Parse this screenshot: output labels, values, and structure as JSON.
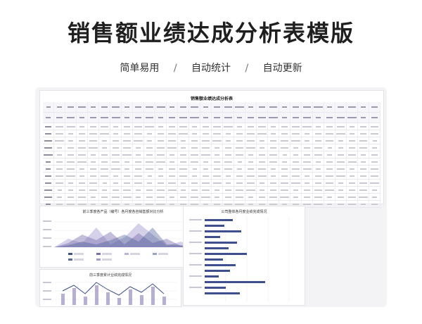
{
  "header": {
    "title": "销售额业绩达成分析表模版",
    "features": [
      "简单易用",
      "自动统计",
      "自动更新"
    ],
    "separator": "/"
  },
  "sheet": {
    "title": "销售额业绩达成分析表"
  },
  "panels": {
    "area_chart_title": "前三季度各产品（编号）各月度各自销售额对比分析",
    "bar_chart_title": "公司整体各月度业绩完成情况",
    "line_chart_title": "前三季度累计业绩完成情况"
  },
  "colors": {
    "accent": "#7b6fb0",
    "accent_light": "#b9b3dc",
    "navy": "#3d4f8c",
    "card_bg": "#f3f3f5"
  }
}
